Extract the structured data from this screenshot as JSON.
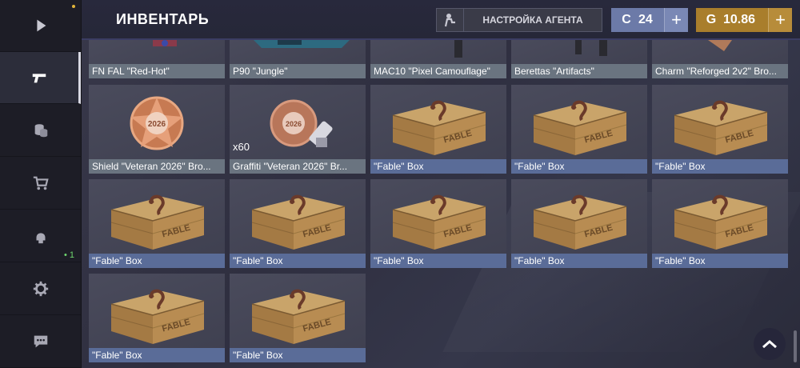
{
  "header": {
    "title": "ИНВЕНТАРЬ",
    "agent_button": "НАСТРОЙКА АГЕНТА",
    "currency_blue": {
      "icon": "C",
      "value": "24",
      "plus": "+"
    },
    "currency_gold": {
      "icon": "G",
      "value": "10.86",
      "plus": "+"
    }
  },
  "sidebar": {
    "items": [
      {
        "icon": "play-icon"
      },
      {
        "icon": "pistol-icon",
        "active": true
      },
      {
        "icon": "coins-icon"
      },
      {
        "icon": "cart-icon"
      },
      {
        "icon": "agent-icon",
        "badge": "• 1"
      },
      {
        "icon": "gear-icon"
      },
      {
        "icon": "chat-icon"
      }
    ]
  },
  "inventory": {
    "row1": [
      "FN FAL \"Red-Hot\"",
      "P90 \"Jungle\"",
      "MAC10 \"Pixel Camouflage\"",
      "Berettas \"Artifacts\"",
      "Charm \"Reforged 2v2\" Bro..."
    ],
    "row2": [
      "Shield \"Veteran 2026\" Bro...",
      "Graffiti \"Veteran 2026\" Br...",
      "\"Fable\" Box",
      "\"Fable\" Box",
      "\"Fable\" Box"
    ],
    "graffiti_count": "x60",
    "row3": [
      "\"Fable\" Box",
      "\"Fable\" Box",
      "\"Fable\" Box",
      "\"Fable\" Box",
      "\"Fable\" Box"
    ],
    "row4": [
      "\"Fable\" Box",
      "\"Fable\" Box"
    ],
    "shield_year": "2026",
    "box_text": "FABLE"
  },
  "colors": {
    "label_gray": "#6a7480",
    "label_blue": "#5a6c98",
    "currency_blue": "#6c7aa8",
    "currency_gold": "#a97e2c"
  }
}
